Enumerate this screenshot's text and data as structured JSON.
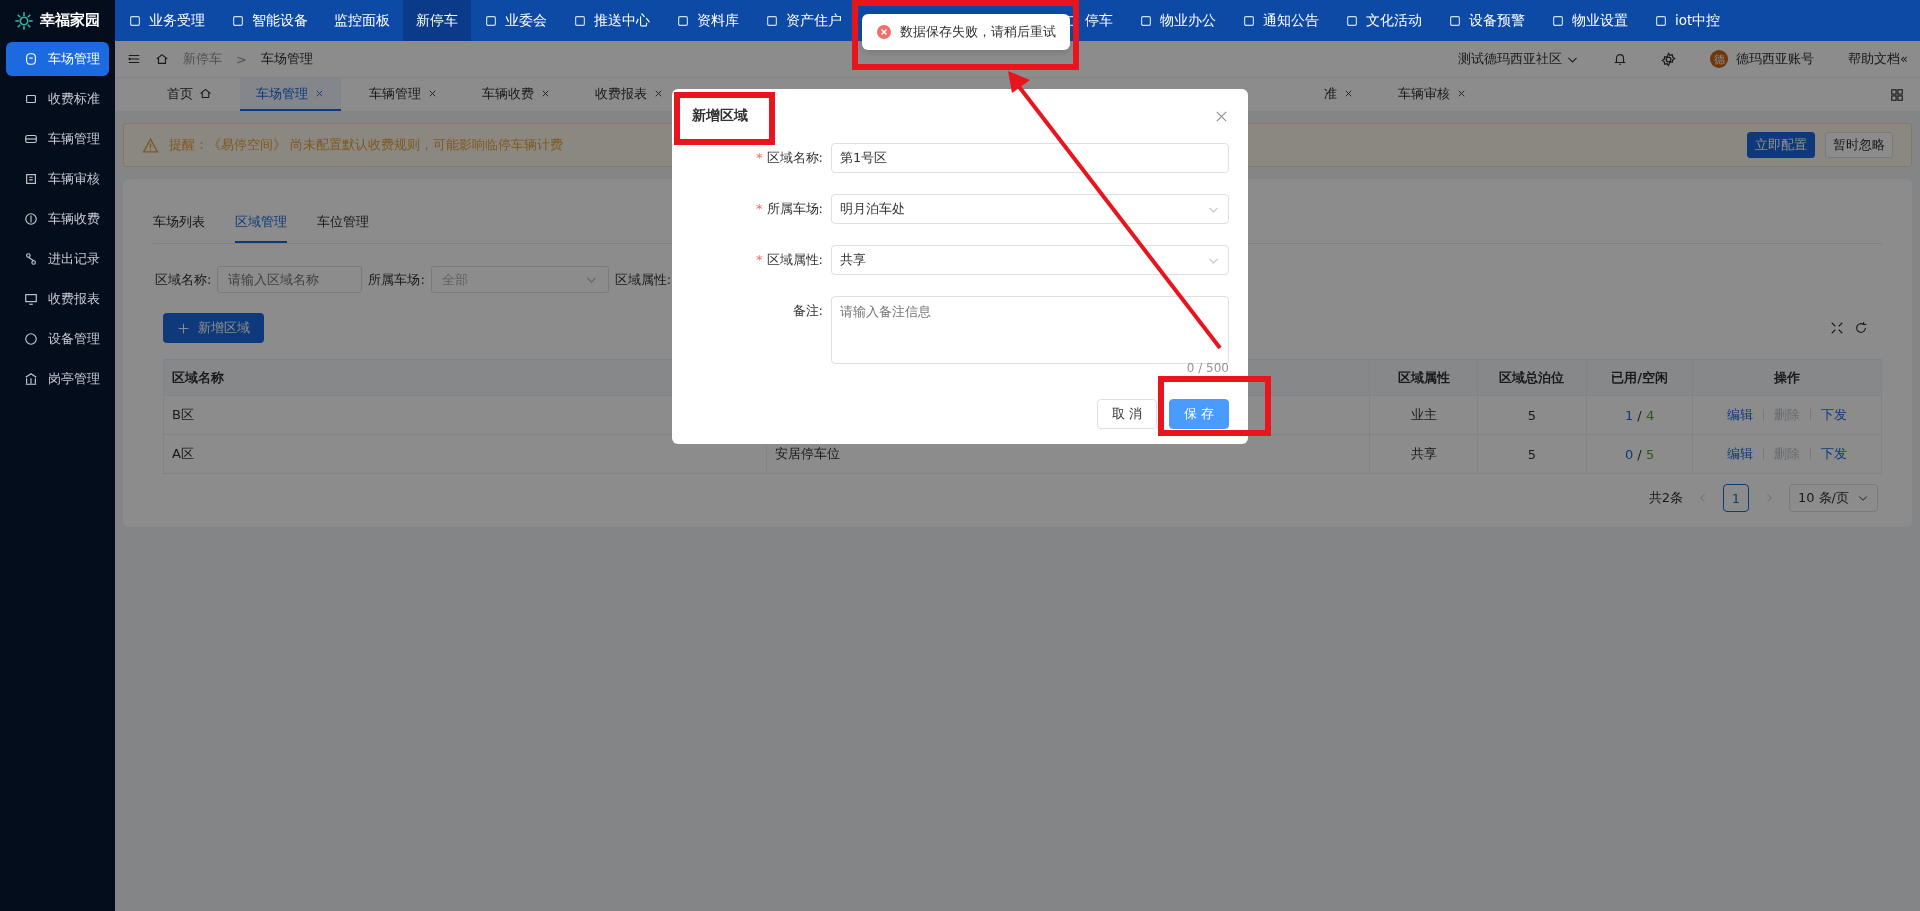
{
  "app": {
    "title": "幸福家园"
  },
  "top_nav": {
    "groups": [
      [
        {
          "label": "业务受理",
          "kind": "icon",
          "selected": false
        },
        {
          "label": "智能设备",
          "kind": "icon",
          "selected": false
        },
        {
          "label": "监控面板",
          "kind": "plain",
          "selected": false
        },
        {
          "label": "新停车",
          "kind": "plain",
          "selected": true
        },
        {
          "label": "业委会",
          "kind": "icon",
          "selected": false
        },
        {
          "label": "推送中心",
          "kind": "icon",
          "selected": false
        },
        {
          "label": "资料库",
          "kind": "icon",
          "selected": false
        },
        {
          "label": "资产住户",
          "kind": "icon",
          "selected": false
        }
      ],
      [
        {
          "label": "停车",
          "kind": "icon",
          "selected": false
        },
        {
          "label": "物业办公",
          "kind": "icon",
          "selected": false
        },
        {
          "label": "通知公告",
          "kind": "icon",
          "selected": false
        },
        {
          "label": "文化活动",
          "kind": "icon",
          "selected": false
        },
        {
          "label": "设备预警",
          "kind": "icon",
          "selected": false
        },
        {
          "label": "物业设置",
          "kind": "icon",
          "selected": false
        },
        {
          "label": "iot中控",
          "kind": "icon",
          "selected": false
        }
      ]
    ]
  },
  "sidebar": {
    "items": [
      {
        "label": "车场管理",
        "selected": true
      },
      {
        "label": "收费标准",
        "selected": false
      },
      {
        "label": "车辆管理",
        "selected": false
      },
      {
        "label": "车辆审核",
        "selected": false
      },
      {
        "label": "车辆收费",
        "selected": false
      },
      {
        "label": "进出记录",
        "selected": false
      },
      {
        "label": "收费报表",
        "selected": false
      },
      {
        "label": "设备管理",
        "selected": false
      },
      {
        "label": "岗亭管理",
        "selected": false
      }
    ]
  },
  "breadcrumb": [
    "新停车",
    ">",
    "车场管理"
  ],
  "header": {
    "community": "测试德玛西亚社区",
    "avatar": "德",
    "account": "德玛西亚账号",
    "help": "帮助文档«"
  },
  "page_tabs": {
    "groups": [
      [
        {
          "label": "首页",
          "kind": "home",
          "selected": false
        },
        {
          "label": "车场管理",
          "kind": "closable",
          "selected": true
        },
        {
          "label": "车辆管理",
          "kind": "closable",
          "selected": false
        },
        {
          "label": "车辆收费",
          "kind": "closable",
          "selected": false
        },
        {
          "label": "收费报表",
          "kind": "closable",
          "selected": false
        }
      ],
      [
        {
          "label": "准",
          "kind": "closable",
          "selected": false
        },
        {
          "label": "车辆审核",
          "kind": "closable",
          "selected": false
        }
      ]
    ]
  },
  "alert": {
    "text": "提醒：《易停空间》 尚未配置默认收费规则，可能影响临停车辆计费",
    "buttons": [
      "立即配置",
      "暂时忽略"
    ]
  },
  "inner_tabs": [
    {
      "label": "车场列表",
      "selected": false
    },
    {
      "label": "区域管理",
      "selected": true
    },
    {
      "label": "车位管理",
      "selected": false
    }
  ],
  "filters": [
    {
      "label": "区域名称:",
      "kind": "input",
      "placeholder": "请输入区域名称"
    },
    {
      "label": "所属车场:",
      "kind": "select",
      "placeholder": "全部"
    },
    {
      "label": "区域属性:",
      "kind": "label"
    }
  ],
  "add_button": "新增区域",
  "table": {
    "columns": [
      "区域名称",
      "",
      "区域属性",
      "区域总泊位",
      "已用/空闲",
      "操作"
    ],
    "rows": [
      {
        "name": "B区",
        "column_2": "",
        "attribute": "业主",
        "total": "5",
        "used": "1",
        "separator": "/",
        "free": "4",
        "actions": [
          {
            "label": "编辑",
            "disabled": false
          },
          {
            "label": "删除",
            "disabled": true
          },
          {
            "label": "下发",
            "disabled": false
          }
        ]
      },
      {
        "name": "A区",
        "column_2": "安居停车位",
        "attribute": "共享",
        "total": "5",
        "used": "0",
        "separator": "/",
        "free": "5",
        "actions": [
          {
            "label": "编辑",
            "disabled": false
          },
          {
            "label": "删除",
            "disabled": true
          },
          {
            "label": "下发",
            "disabled": false
          }
        ]
      }
    ]
  },
  "pagination": {
    "total": "共2条",
    "pages": [
      {
        "label": "1",
        "selected": true
      }
    ],
    "page_size": "10 条/页"
  },
  "dialog": {
    "title": "新增区域",
    "required_mark": "*",
    "fields": [
      {
        "label": "区域名称:",
        "kind": "input",
        "required": true,
        "value": "第1号区"
      },
      {
        "label": "所属车场:",
        "kind": "select",
        "required": true,
        "value": "明月泊车处"
      },
      {
        "label": "区域属性:",
        "kind": "select",
        "required": true,
        "value": "共享"
      },
      {
        "label": "备注:",
        "kind": "textarea",
        "required": false,
        "placeholder": "请输入备注信息",
        "counter": "0 / 500"
      }
    ],
    "buttons": [
      {
        "label": "取 消",
        "kind": "secondary"
      },
      {
        "label": "保 存",
        "kind": "primary"
      }
    ]
  },
  "toast": {
    "kind": "error",
    "text": "数据保存失败，请稍后重试"
  }
}
